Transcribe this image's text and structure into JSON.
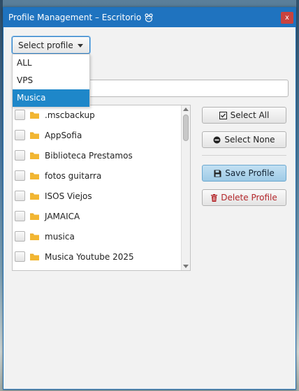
{
  "window": {
    "title": "Profile Management – Escritorio",
    "close_label": "x"
  },
  "profile_select": {
    "label": "Select profile",
    "options": [
      "ALL",
      "VPS",
      "Musica"
    ],
    "highlighted": "Musica"
  },
  "filter": {
    "value": ""
  },
  "folders": [
    {
      "name": ".mscbackup",
      "checked": false
    },
    {
      "name": "AppSofia",
      "checked": false
    },
    {
      "name": "Biblioteca Prestamos",
      "checked": false
    },
    {
      "name": "fotos guitarra",
      "checked": false
    },
    {
      "name": "ISOS Viejos",
      "checked": false
    },
    {
      "name": "JAMAICA",
      "checked": false
    },
    {
      "name": "musica",
      "checked": false
    },
    {
      "name": "Musica Youtube 2025",
      "checked": false
    }
  ],
  "actions": {
    "select_all": "Select All",
    "select_none": "Select None",
    "save_profile": "Save Profile",
    "delete_profile": "Delete Profile"
  },
  "colors": {
    "titlebar": "#1f73bf",
    "close_button": "#c9433f",
    "selection": "#1e87c9",
    "folder": "#f2b632",
    "delete_text": "#b3262a"
  }
}
